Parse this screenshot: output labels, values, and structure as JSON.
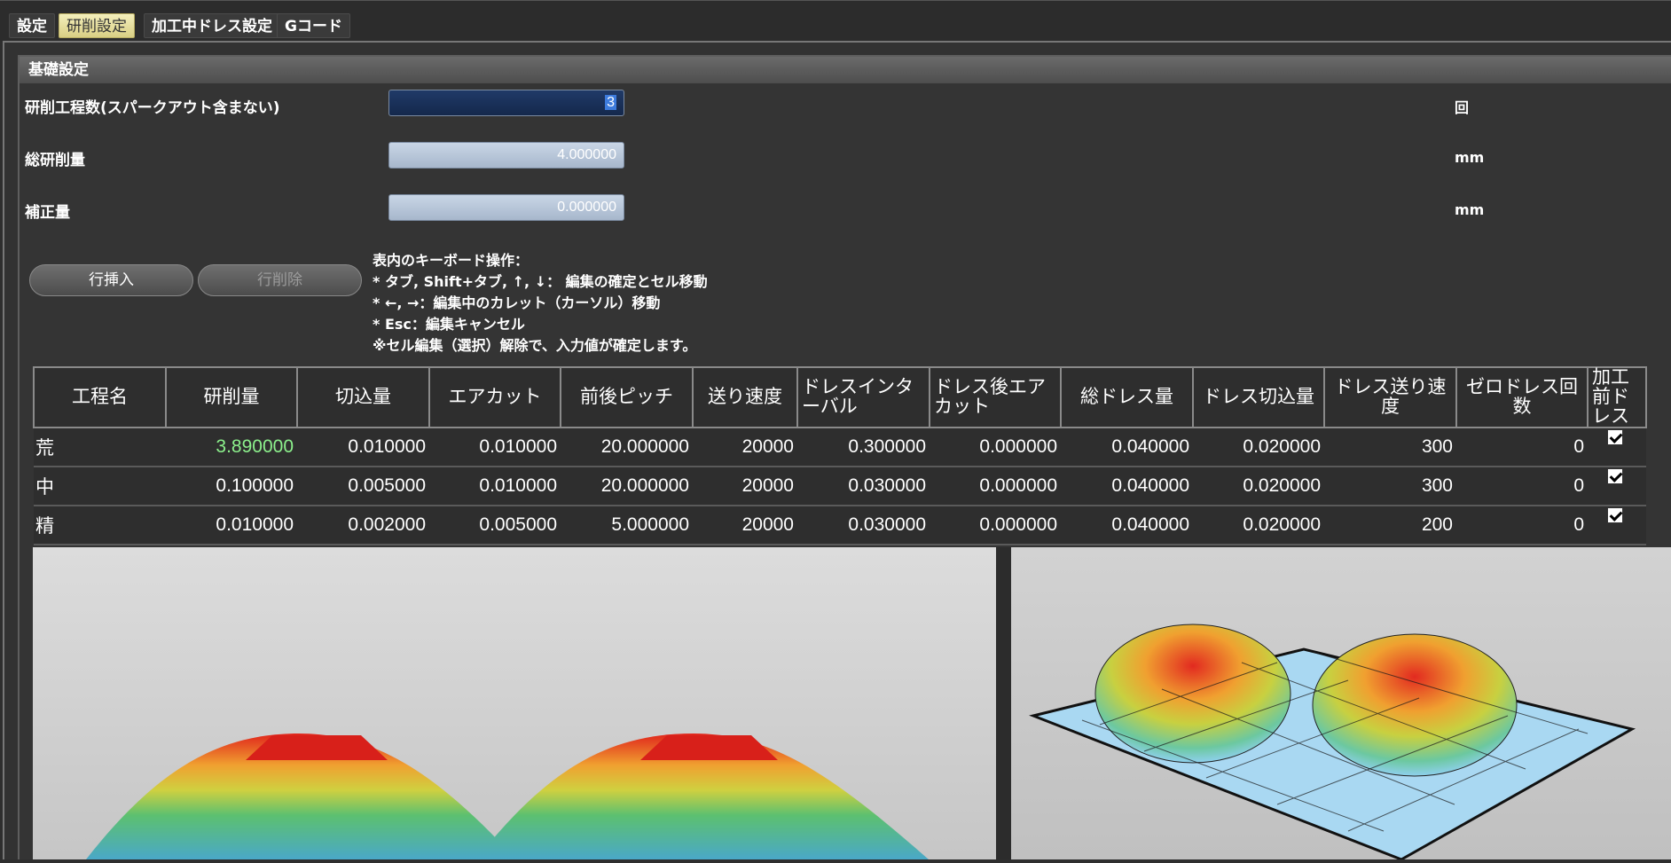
{
  "tabs": [
    "設定",
    "研削設定",
    "加工中ドレス設定",
    "Gコード"
  ],
  "group_title": "基礎設定",
  "fields": [
    {
      "label": "研削工程数(スパークアウト含まない)",
      "value": "3",
      "unit": "回"
    },
    {
      "label": "総研削量",
      "value": "4.000000",
      "unit": "mm"
    },
    {
      "label": "補正量",
      "value": "0.000000",
      "unit": "mm"
    }
  ],
  "buttons": {
    "insert": "行挿入",
    "delete": "行削除"
  },
  "help_lines": [
    "表内のキーボード操作：",
    "* タブ, Shift+タブ, ↑, ↓：  編集の確定とセル移動",
    "* ←, →：編集中のカレット（カーソル）移動",
    "* Esc：編集キャンセル",
    "※セル編集（選択）解除で、入力値が確定します。"
  ],
  "table": {
    "headers": [
      "工程名",
      "研削量",
      "切込量",
      "エアカット",
      "前後ピッチ",
      "送り速度",
      "ドレスインターバル",
      "ドレス後エアカット",
      "総ドレス量",
      "ドレス切込量",
      "ドレス送り速度",
      "ゼロドレス回数",
      "加工前ドレス"
    ],
    "rows": [
      [
        "荒",
        "3.890000",
        "0.010000",
        "0.010000",
        "20.000000",
        "20000",
        "0.300000",
        "0.000000",
        "0.040000",
        "0.020000",
        "300",
        "0"
      ],
      [
        "中",
        "0.100000",
        "0.005000",
        "0.010000",
        "20.000000",
        "20000",
        "0.030000",
        "0.000000",
        "0.040000",
        "0.020000",
        "300",
        "0"
      ],
      [
        "精",
        "0.010000",
        "0.002000",
        "0.005000",
        "5.000000",
        "20000",
        "0.030000",
        "0.000000",
        "0.040000",
        "0.020000",
        "200",
        "0"
      ]
    ],
    "checked": [
      true,
      true,
      true
    ]
  },
  "colors": {
    "accent_tab": "#e6dd9c",
    "highlight_value": "#8cf08c",
    "selected_input": "#14284c"
  }
}
